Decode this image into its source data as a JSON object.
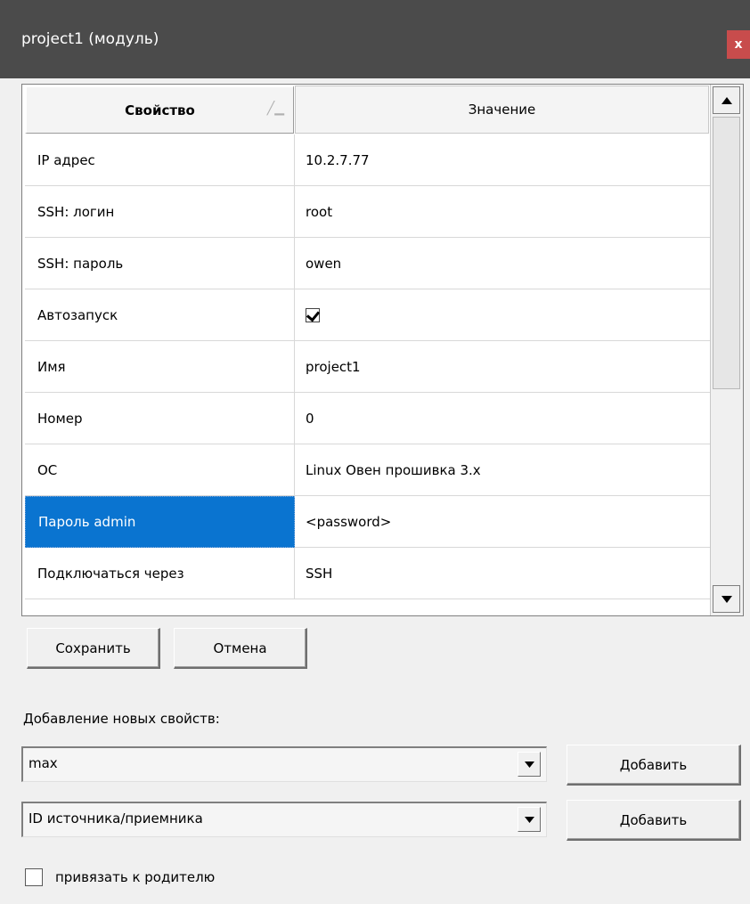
{
  "window": {
    "title": "project1 (модуль)",
    "close_label": "x"
  },
  "grid": {
    "headers": {
      "property": "Свойство",
      "value": "Значение"
    },
    "rows": [
      {
        "property": "IP адрес",
        "value": "10.2.7.77"
      },
      {
        "property": "SSH: логин",
        "value": "root"
      },
      {
        "property": "SSH: пароль",
        "value": "owen"
      },
      {
        "property": "Автозапуск",
        "value": "",
        "checkbox": true,
        "checked": true
      },
      {
        "property": "Имя",
        "value": "project1"
      },
      {
        "property": "Номер",
        "value": "0"
      },
      {
        "property": "ОС",
        "value": "Linux Овен прошивка 3.x"
      },
      {
        "property": "Пароль admin",
        "value": "<password>",
        "selected": true
      },
      {
        "property": "Подключаться через",
        "value": "SSH"
      }
    ]
  },
  "buttons": {
    "save": "Сохранить",
    "cancel": "Отмена"
  },
  "add_section": {
    "label": "Добавление новых свойств:",
    "combo1_value": "max",
    "combo2_value": "ID источника/приемника",
    "add_label": "Добавить"
  },
  "bind_parent": {
    "label": "привязать к родителю",
    "checked": false
  },
  "colors": {
    "titlebar": "#4b4b4b",
    "close": "#c84c4c",
    "selection": "#0a74d0"
  }
}
